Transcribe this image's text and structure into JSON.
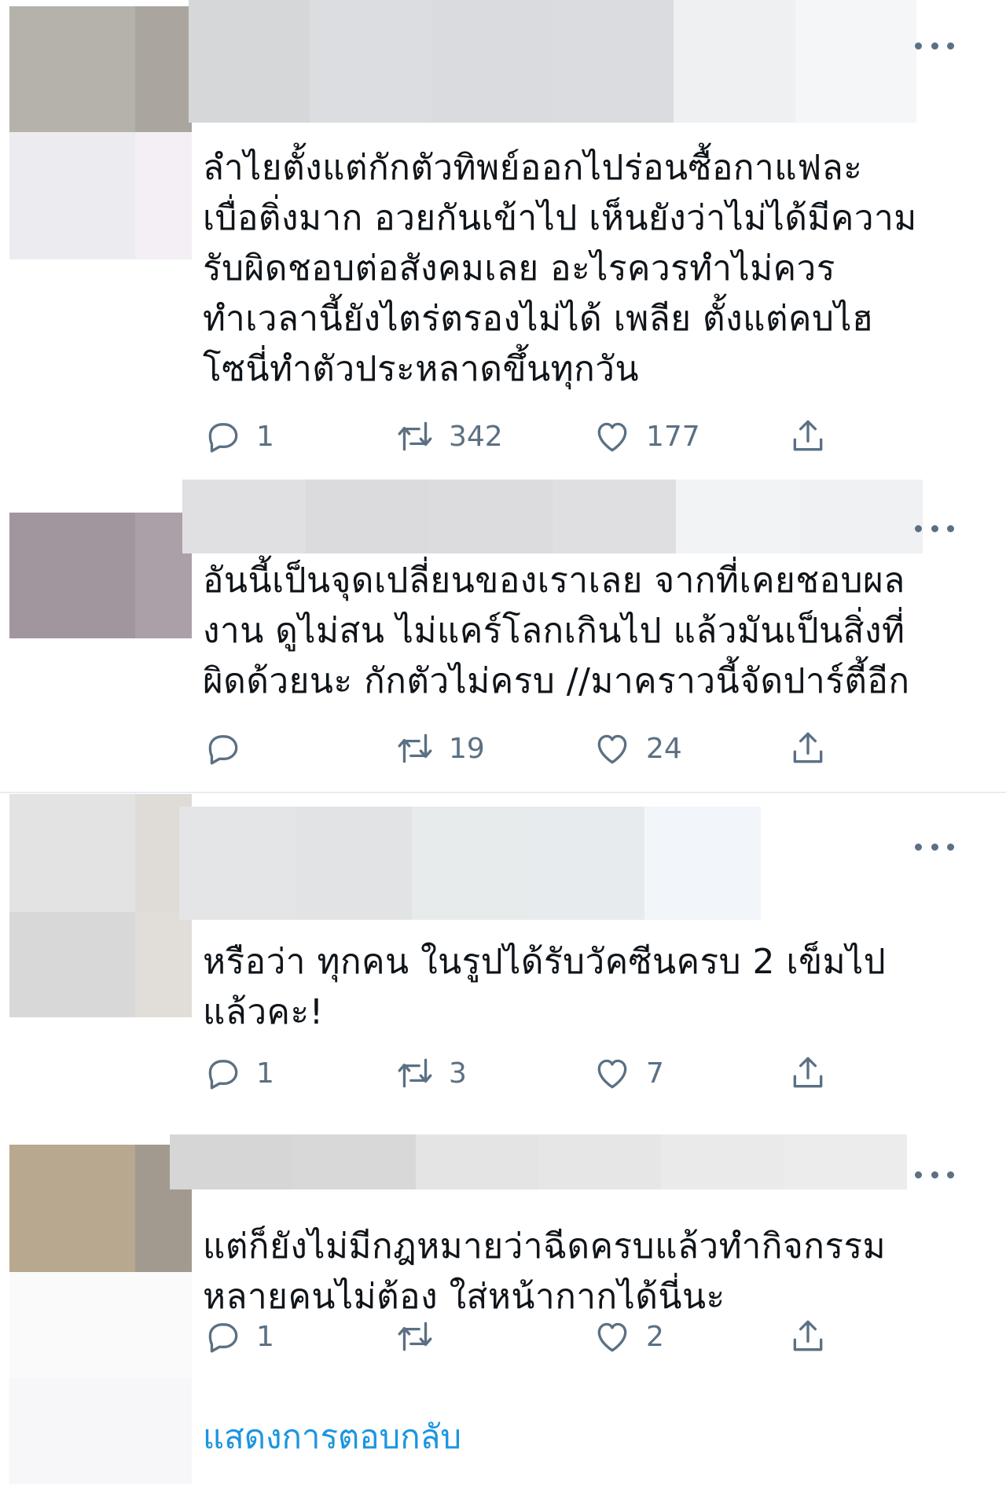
{
  "tweets": [
    {
      "text": "ลำไยตั้งแต่กักตัวทิพย์ออกไปร่อนซื้อกาแฟละ\nเบื่อติ่งมาก อวยกันเข้าไป เห็นยังว่าไม่ได้มีความ\nรับผิดชอบต่อสังคมเลย อะไรควรทำไม่ควร\nทำเวลานี้ยังไตร่ตรองไม่ได้ เพลีย ตั้งแต่คบไฮ\nโซนี่ทำตัวประหลาดขึ้นทุกวัน",
      "replies": "1",
      "retweets": "342",
      "likes": "177"
    },
    {
      "text": "อันนี้เป็นจุดเปลี่ยนของเราเลย จากที่เคยชอบผล\nงาน ดูไม่สน ไม่แคร์โลกเกินไป แล้วมันเป็นสิ่งที่\nผิดด้วยนะ กักตัวไม่ครบ //มาคราวนี้จัดปาร์ตี้อีก",
      "replies": "",
      "retweets": "19",
      "likes": "24"
    },
    {
      "text": "หรือว่า ทุกคน ในรูปได้รับวัคซีนครบ 2 เข็มไป\nแล้วคะ!",
      "replies": "1",
      "retweets": "3",
      "likes": "7"
    },
    {
      "text": "แต่ก็ยังไม่มีกฎหมายว่าฉีดครบแล้วทำกิจกรรม\nหลายคนไม่ต้อง ใส่หน้ากากได้นี่นะ",
      "replies": "1",
      "retweets": "",
      "likes": "2"
    }
  ],
  "show_replies_label": "แสดงการตอบกลับ",
  "icons": {
    "reply": "reply-icon",
    "retweet": "retweet-icon",
    "like": "heart-icon",
    "share": "share-icon",
    "more": "more-icon"
  },
  "colors": {
    "link": "#1b95e0",
    "muted": "#5b7083",
    "text": "#0f1419"
  }
}
